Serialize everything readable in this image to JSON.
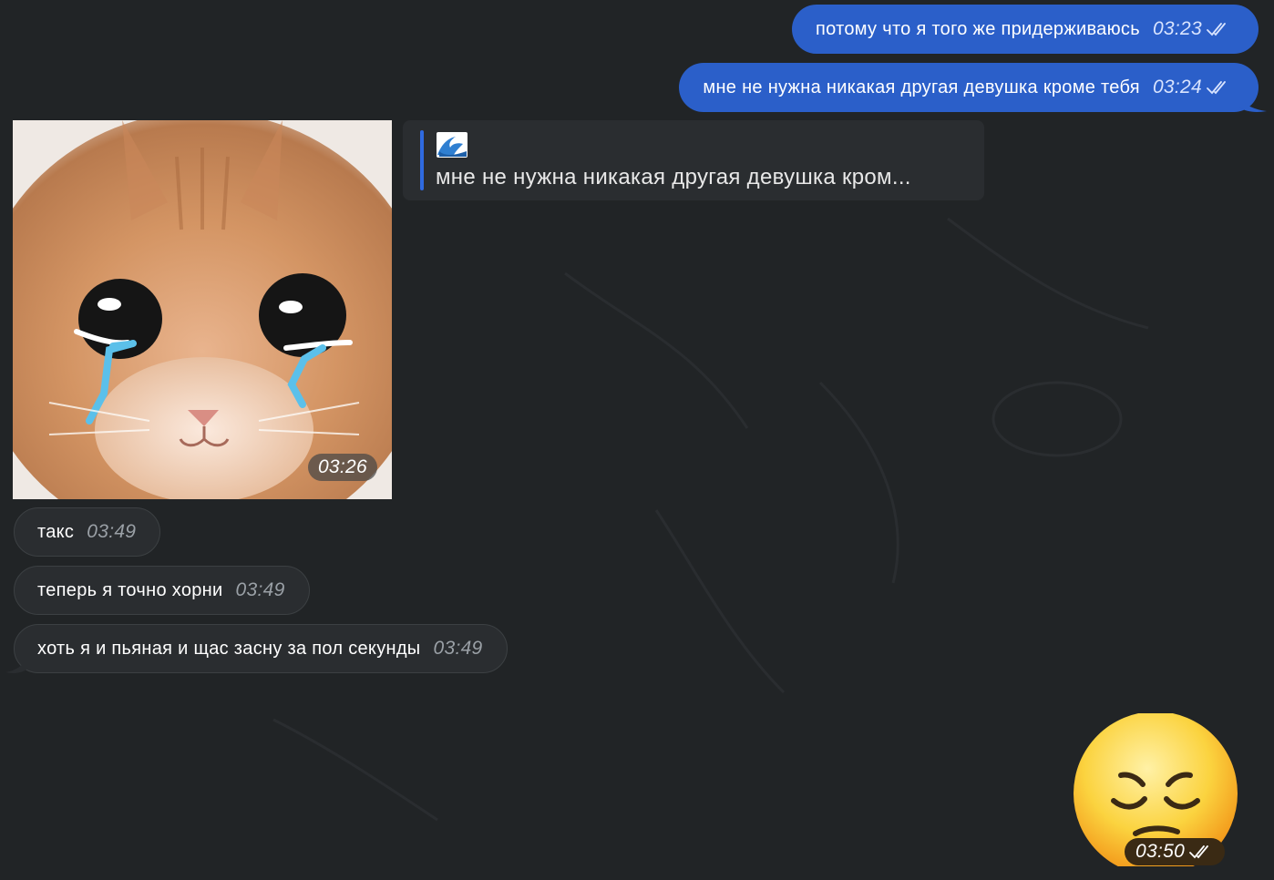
{
  "messages": {
    "out1": {
      "text": "потому что я того же придерживаюсь",
      "time": "03:23"
    },
    "out2": {
      "text": "мне не нужна никакая другая девушка кроме тебя",
      "time": "03:24"
    },
    "photo": {
      "time": "03:26"
    },
    "reply": {
      "icon": "wave-emoji-icon",
      "text": "мне не нужна никакая другая девушка кром..."
    },
    "in1": {
      "text": "такс",
      "time": "03:49"
    },
    "in2": {
      "text": "теперь я точно хорни",
      "time": "03:49"
    },
    "in3": {
      "text": "хоть я и пьяная и щас засну за пол секунды",
      "time": "03:49"
    },
    "emoji": {
      "icon": "pensive-face-emoji-icon",
      "time": "03:50"
    }
  },
  "colors": {
    "background": "#212426",
    "outgoing_bubble": "#2b5fc9",
    "incoming_bubble": "#2a2d30",
    "reply_bar": "#2f6ae0"
  }
}
